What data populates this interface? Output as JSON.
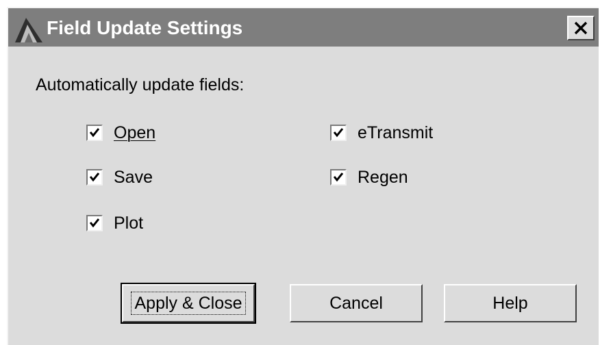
{
  "dialog": {
    "title": "Field Update Settings",
    "close_label": "X"
  },
  "prompt": "Automatically update fields:",
  "options": [
    {
      "label": "Open",
      "checked": true
    },
    {
      "label": "Save",
      "checked": true
    },
    {
      "label": "Plot",
      "checked": true
    },
    {
      "label": "eTransmit",
      "checked": true
    },
    {
      "label": "Regen",
      "checked": true
    }
  ],
  "buttons": {
    "apply_close": "Apply & Close",
    "cancel": "Cancel",
    "help": "Help"
  },
  "icons": {
    "title": "app-icon",
    "close": "close-icon",
    "check": "checkmark-icon"
  },
  "colors": {
    "titlebar": "#7e7e7e",
    "dialog_face": "#dcdcdc"
  }
}
